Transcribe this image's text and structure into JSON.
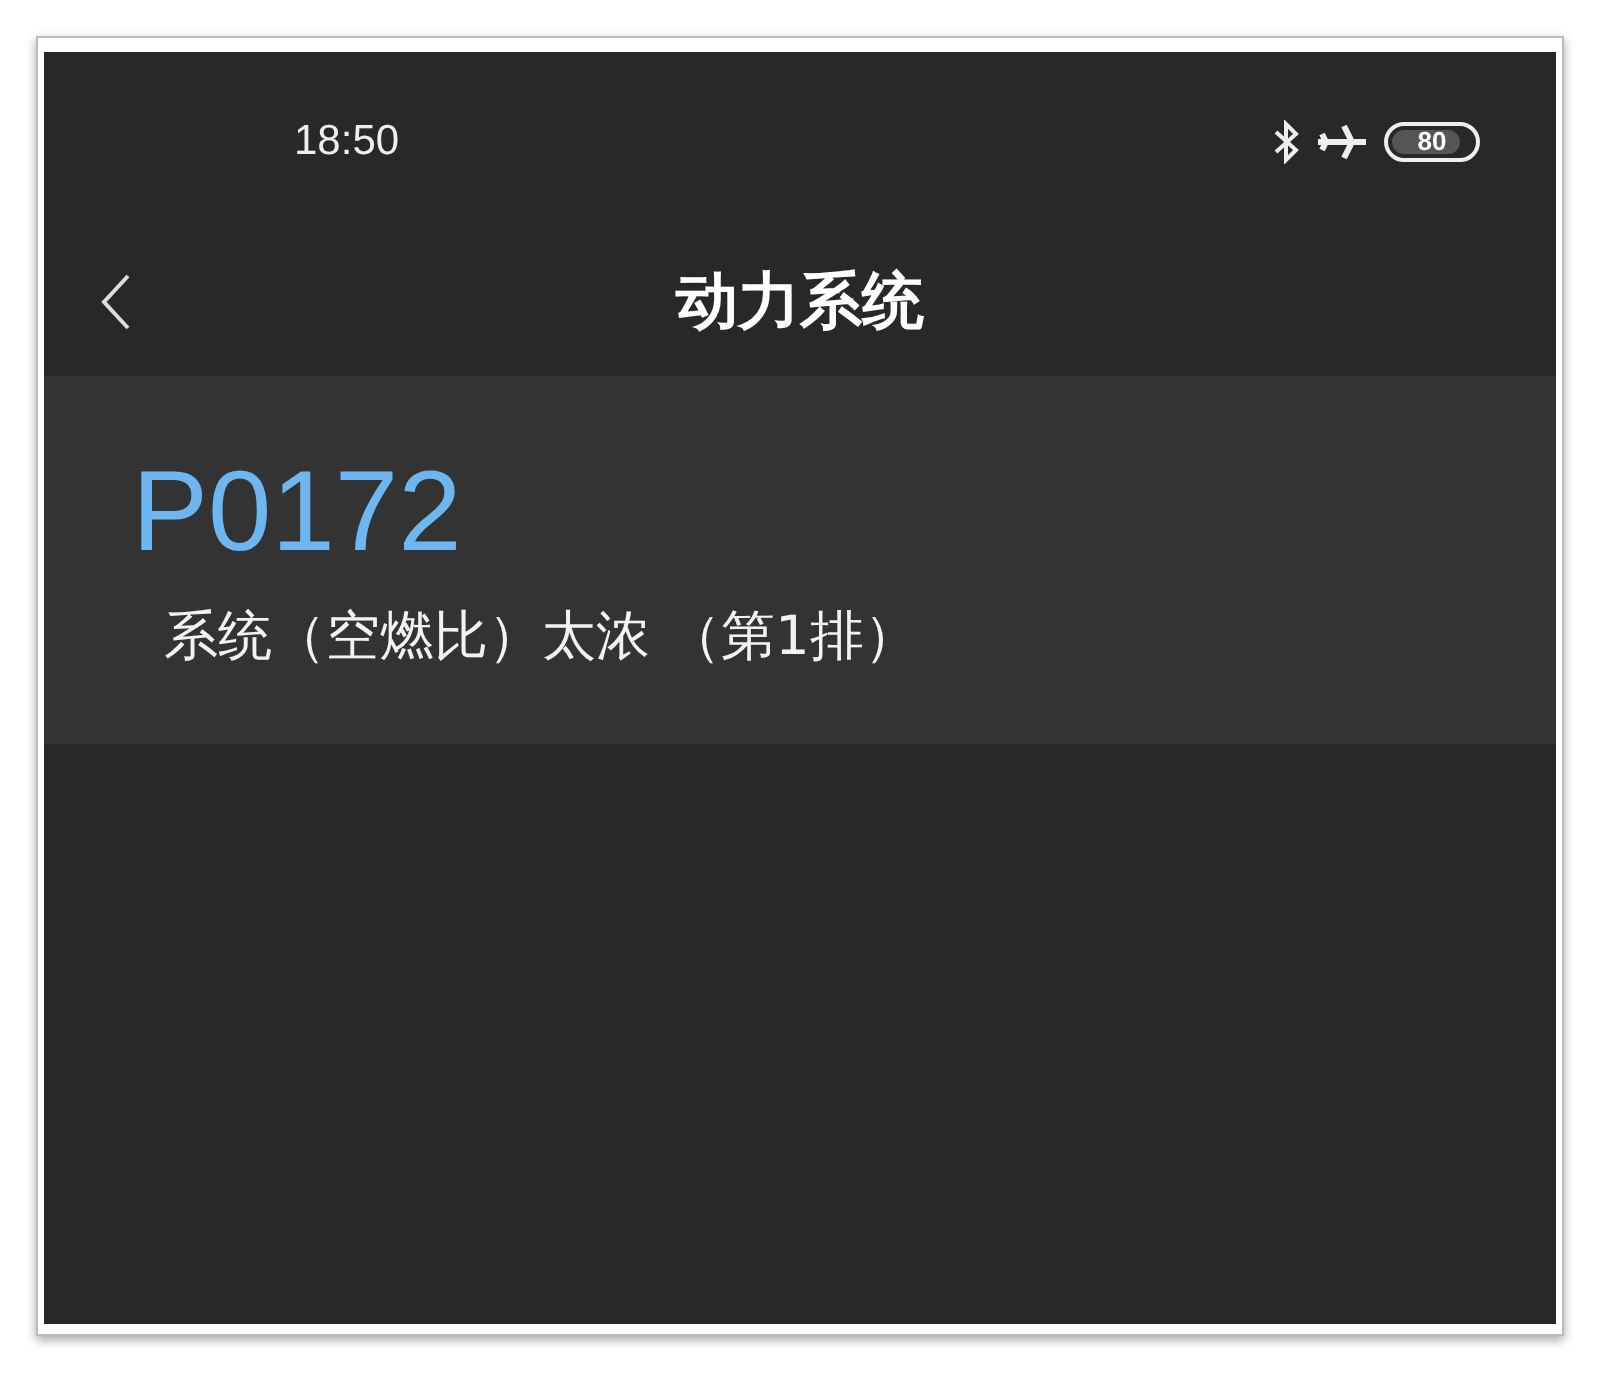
{
  "status_bar": {
    "time": "18:50",
    "battery": "80"
  },
  "header": {
    "title": "动力系统"
  },
  "fault": {
    "code": "P0172",
    "description": "系统（空燃比）太浓 （第1排）"
  }
}
